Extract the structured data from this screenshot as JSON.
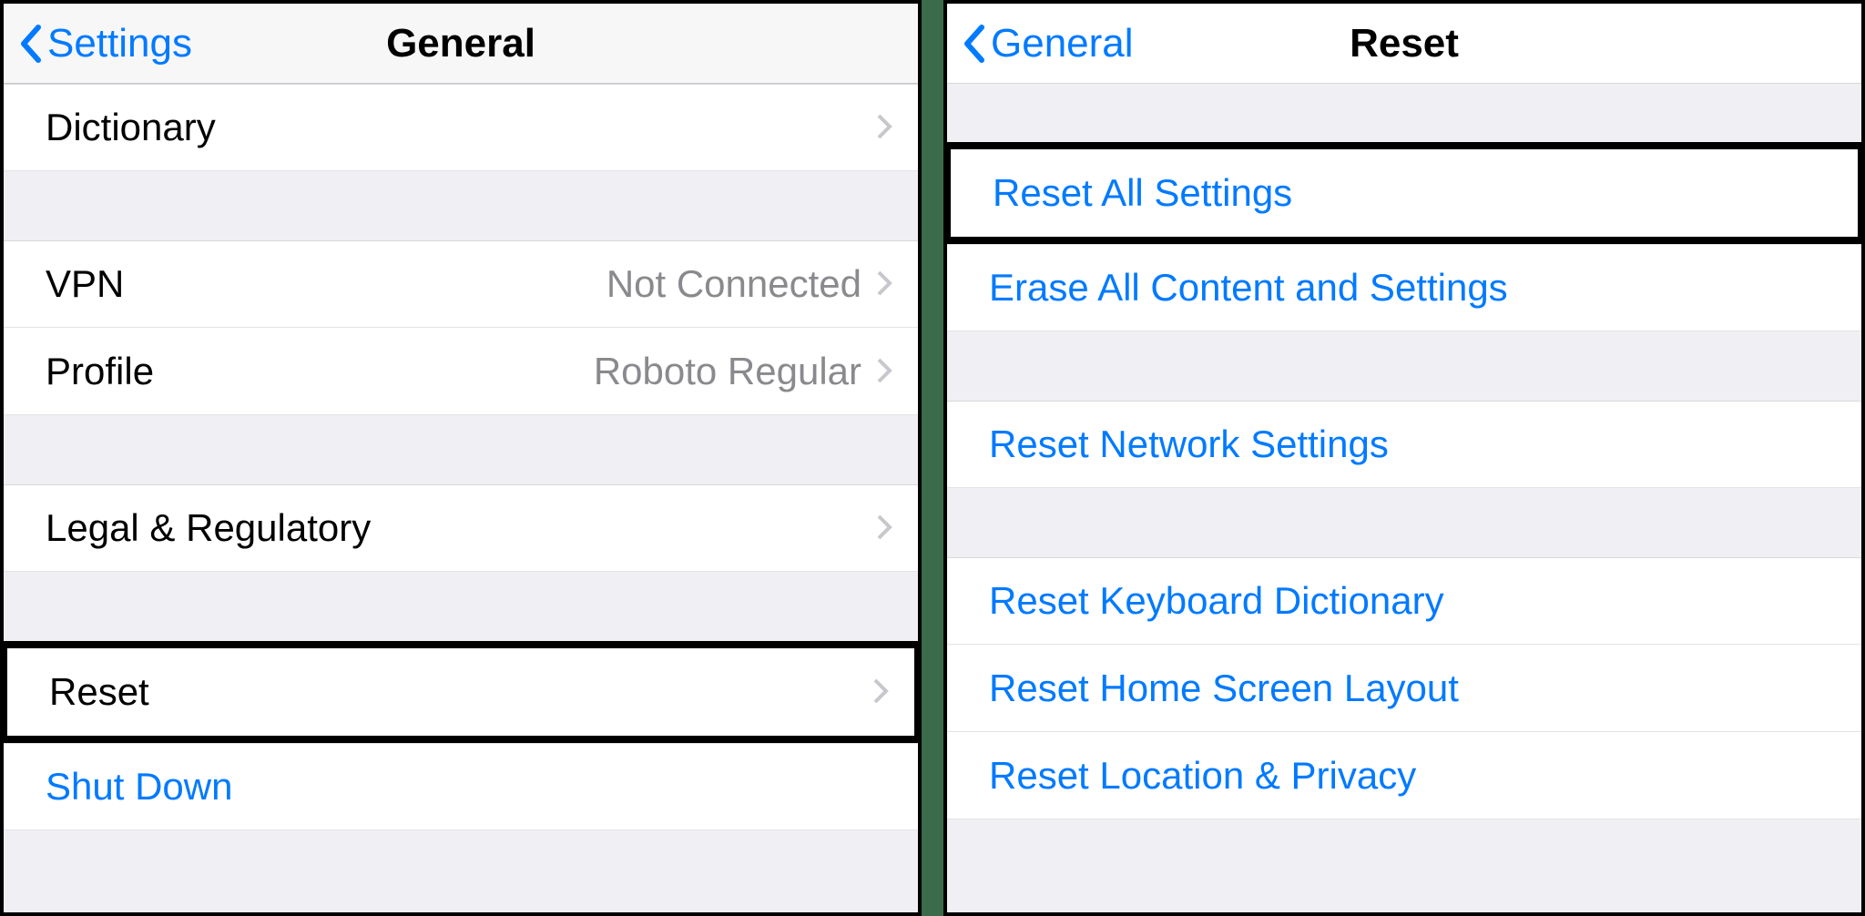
{
  "left_panel": {
    "back_label": "Settings",
    "title": "General",
    "rows": {
      "dictionary": {
        "label": "Dictionary",
        "detail": "",
        "chevron": true
      },
      "vpn": {
        "label": "VPN",
        "detail": "Not Connected",
        "chevron": true
      },
      "profile": {
        "label": "Profile",
        "detail": "Roboto Regular",
        "chevron": true
      },
      "legal": {
        "label": "Legal & Regulatory",
        "detail": "",
        "chevron": true
      },
      "reset": {
        "label": "Reset",
        "detail": "",
        "chevron": true
      },
      "shutdown": {
        "label": "Shut Down",
        "detail": "",
        "chevron": false
      }
    }
  },
  "right_panel": {
    "back_label": "General",
    "title": "Reset",
    "rows": {
      "reset_all": {
        "label": "Reset All Settings"
      },
      "erase_all": {
        "label": "Erase All Content and Settings"
      },
      "reset_network": {
        "label": "Reset Network Settings"
      },
      "reset_keyboard": {
        "label": "Reset Keyboard Dictionary"
      },
      "reset_home": {
        "label": "Reset Home Screen Layout"
      },
      "reset_location": {
        "label": "Reset Location & Privacy"
      }
    }
  },
  "colors": {
    "link": "#007aff",
    "bg": "#efeff4",
    "secondary_text": "#8a8a8e"
  }
}
